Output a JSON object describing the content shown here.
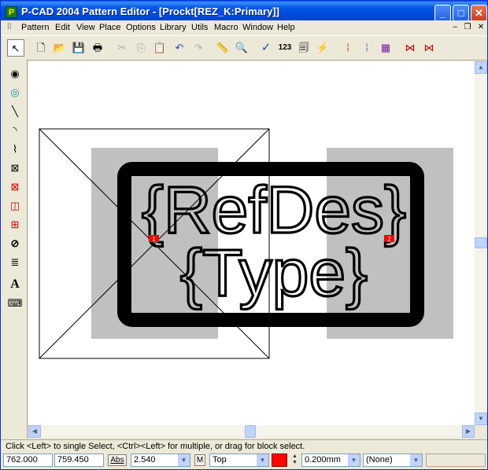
{
  "window": {
    "title": "P-CAD 2004 Pattern Editor - [Prockt[REZ_K:Primary]]",
    "app_icon_glyph": "P",
    "minimize_glyph": "_",
    "maximize_glyph": "□",
    "close_glyph": "✕"
  },
  "menubar": {
    "items": [
      "Pattern",
      "Edit",
      "View",
      "Place",
      "Options",
      "Library",
      "Utils",
      "Macro",
      "Window",
      "Help"
    ],
    "mdi_minimize": "–",
    "mdi_restore": "❐",
    "mdi_close": "✕"
  },
  "toolbar": {
    "items": [
      {
        "name": "select-arrow-icon",
        "glyph": "↖"
      },
      {
        "name": "new-file-icon",
        "glyph": "🗋"
      },
      {
        "name": "open-folder-icon",
        "glyph": "📂"
      },
      {
        "name": "save-disk-icon",
        "glyph": "💾"
      },
      {
        "name": "print-icon",
        "glyph": "🖶"
      },
      {
        "name": "cut-icon",
        "glyph": "✂"
      },
      {
        "name": "copy-icon",
        "glyph": "⎘"
      },
      {
        "name": "paste-icon",
        "glyph": "📋"
      },
      {
        "name": "undo-icon",
        "glyph": "↶"
      },
      {
        "name": "redo-icon",
        "glyph": "↷"
      },
      {
        "name": "measure-icon",
        "glyph": "📏"
      },
      {
        "name": "zoom-icon",
        "glyph": "🔍"
      },
      {
        "name": "check-icon",
        "glyph": "✓"
      },
      {
        "name": "renumber-icon",
        "glyph": "123"
      },
      {
        "name": "report-icon",
        "glyph": "🗐"
      },
      {
        "name": "lightning-icon",
        "glyph": "⚡"
      },
      {
        "name": "pad-grid-icon",
        "glyph": "⁞"
      },
      {
        "name": "pad-grid-alt-icon",
        "glyph": "⁞"
      },
      {
        "name": "component-icon",
        "glyph": "▦"
      },
      {
        "name": "pins-horizontal-icon",
        "glyph": "⋈"
      },
      {
        "name": "pins-horizontal-alt-icon",
        "glyph": "⋈"
      }
    ]
  },
  "left_tools": [
    {
      "name": "select-point-icon",
      "glyph": "◉"
    },
    {
      "name": "zoom-point-icon",
      "glyph": "◎"
    },
    {
      "name": "place-line-icon",
      "glyph": "╲"
    },
    {
      "name": "place-arc-icon",
      "glyph": "◝"
    },
    {
      "name": "place-polygon-icon",
      "glyph": "⌇"
    },
    {
      "name": "place-pad-icon",
      "glyph": "⊠"
    },
    {
      "name": "place-via-icon",
      "glyph": "⊠"
    },
    {
      "name": "place-copper-icon",
      "glyph": "◫"
    },
    {
      "name": "place-point-icon",
      "glyph": "⊞"
    },
    {
      "name": "keepout-icon",
      "glyph": "⊘"
    },
    {
      "name": "place-attribute-icon",
      "glyph": "≣"
    },
    {
      "name": "place-text-icon",
      "glyph": "A"
    },
    {
      "name": "place-field-icon",
      "glyph": "⌨"
    }
  ],
  "pattern": {
    "refdes_text": "{RefDes}",
    "type_text": "{Type}",
    "pad1_label": "1",
    "pad2_label": "2",
    "pad_color": "#c0c0c0",
    "pad_number_color": "#ff0000"
  },
  "status": {
    "message": "Click <Left> to single Select, <Ctrl><Left> for multiple, or drag for block select."
  },
  "bottombar": {
    "x_coord": "762.000",
    "y_coord": "759.450",
    "abs_label": "Abs",
    "grid_value": "2.540",
    "m_label": "M",
    "layer": "Top",
    "layer_color": "#ff0000",
    "line_width": "0.200mm",
    "style": "(None)"
  }
}
